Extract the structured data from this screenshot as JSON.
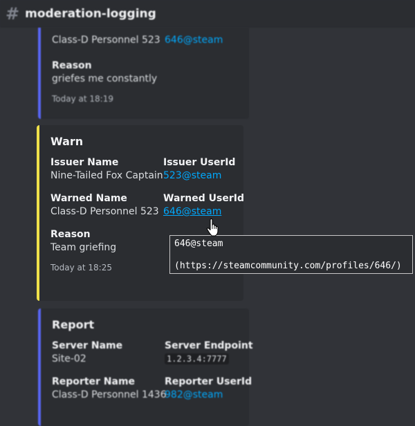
{
  "channel": {
    "hash": "#",
    "name": "moderation-logging"
  },
  "prev_embed": {
    "value": "Class-D Personnel 523",
    "userid": "646@steam",
    "reason_label": "Reason",
    "reason": "griefes me constantly",
    "timestamp": "Today at 18:19",
    "accent": "#5865f2"
  },
  "warn_embed": {
    "title": "Warn",
    "accent": "#f0e14a",
    "issuer_name_label": "Issuer Name",
    "issuer_name": "Nine-Tailed Fox Captain",
    "issuer_userid_label": "Issuer UserId",
    "issuer_userid": "523@steam",
    "warned_name_label": "Warned Name",
    "warned_name": "Class-D Personnel 523",
    "warned_userid_label": "Warned UserId",
    "warned_userid": "646@steam",
    "reason_label": "Reason",
    "reason": "Team griefing",
    "timestamp": "Today at 18:25"
  },
  "tooltip": {
    "line1": "646@steam",
    "line2": "(https://steamcommunity.com/profiles/646/)"
  },
  "report_embed": {
    "title": "Report",
    "accent": "#5865f2",
    "server_name_label": "Server Name",
    "server_name": "Site-02",
    "server_endpoint_label": "Server Endpoint",
    "server_endpoint": "1.2.3.4:7777",
    "reporter_name_label": "Reporter Name",
    "reporter_name": "Class-D Personnel 1436",
    "reporter_userid_label": "Reporter UserId",
    "reporter_userid": "982@steam"
  }
}
